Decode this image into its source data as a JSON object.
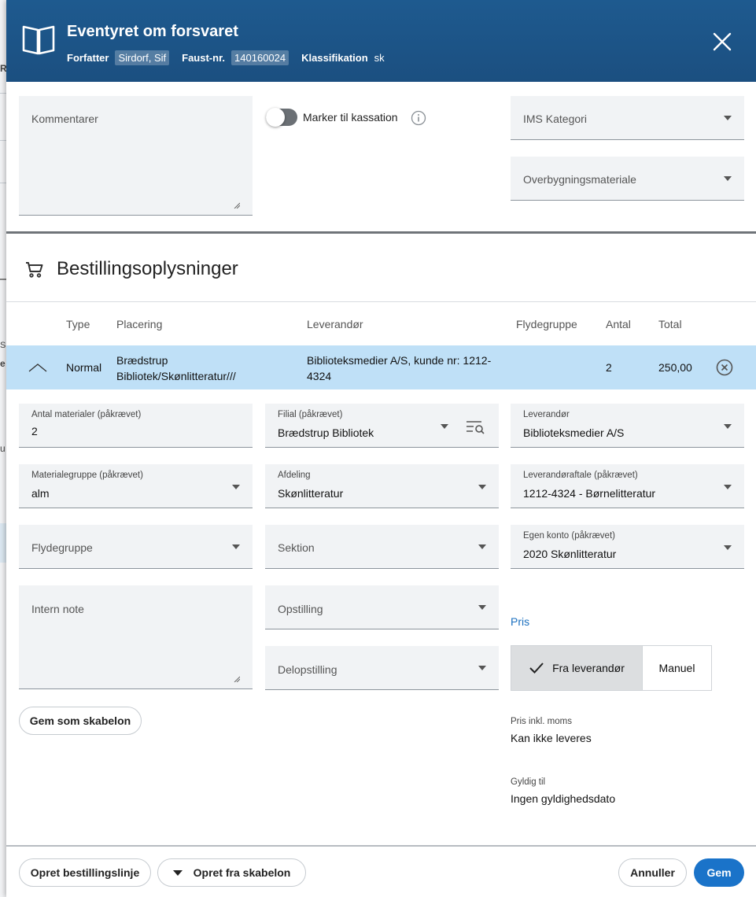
{
  "background": {
    "fragments": [
      "R",
      "S",
      "e",
      "u"
    ]
  },
  "header": {
    "title": "Eventyret om forsvaret",
    "author_label": "Forfatter",
    "author_value": "Sirdorf, Sif",
    "faust_label": "Faust-nr.",
    "faust_value": "140160024",
    "class_label": "Klassifikation",
    "class_value": "sk"
  },
  "top": {
    "kommentarer_label": "Kommentarer",
    "toggle_label": "Marker til kassation",
    "ims_kategori_label": "IMS Kategori",
    "overbygning_label": "Overbygningsmateriale"
  },
  "section": {
    "title": "Bestillingsoplysninger"
  },
  "table": {
    "headers": [
      "Type",
      "Placering",
      "Leverandør",
      "Flydegruppe",
      "Antal",
      "Total"
    ],
    "row": {
      "type": "Normal",
      "placering_line1": "Brædstrup",
      "placering_line2": "Bibliotek/Skønlitteratur///",
      "leverandor_line1": "Biblioteksmedier A/S, kunde nr: 1212-",
      "leverandor_line2": "4324",
      "flydegruppe": "",
      "antal": "2",
      "total": "250,00"
    }
  },
  "form": {
    "antal_label": "Antal materialer (påkrævet)",
    "antal_value": "2",
    "filial_label": "Filial (påkrævet)",
    "filial_value": "Brædstrup Bibliotek",
    "leverandor_label": "Leverandør",
    "leverandor_value": "Biblioteksmedier A/S",
    "materialegruppe_label": "Materialegruppe (påkrævet)",
    "materialegruppe_value": "alm",
    "afdeling_label": "Afdeling",
    "afdeling_value": "Skønlitteratur",
    "leverandoraftale_label": "Leverandøraftale (påkrævet)",
    "leverandoraftale_value": "1212-4324 - Børnelitteratur",
    "flydegruppe_label": "Flydegruppe",
    "sektion_label": "Sektion",
    "egen_konto_label": "Egen konto (påkrævet)",
    "egen_konto_value": "2020 Skønlitteratur",
    "intern_note_label": "Intern note",
    "opstilling_label": "Opstilling",
    "delopstilling_label": "Delopstilling",
    "gem_skabelon_label": "Gem som skabelon"
  },
  "pris": {
    "label": "Pris",
    "option_selected": "Fra leverandør",
    "option_other": "Manuel",
    "inkl_moms_label": "Pris inkl. moms",
    "inkl_moms_value": "Kan ikke leveres",
    "gyldig_label": "Gyldig til",
    "gyldig_value": "Ingen gyldighedsdato"
  },
  "footer": {
    "opret_linje": "Opret bestillingslinje",
    "opret_skabelon": "Opret fra skabelon",
    "annuller": "Annuller",
    "gem": "Gem"
  },
  "colors": {
    "header_bg": "#1b4f80",
    "row_highlight": "#bfe0f7",
    "primary": "#1a73c9",
    "link": "#1a6fbf"
  },
  "icons": [
    "book-icon",
    "close-icon",
    "info-icon",
    "cart-icon",
    "chevron-up-icon",
    "remove-icon",
    "chevron-down-icon",
    "list-search-icon",
    "checkmark-icon",
    "triangle-down-icon"
  ]
}
